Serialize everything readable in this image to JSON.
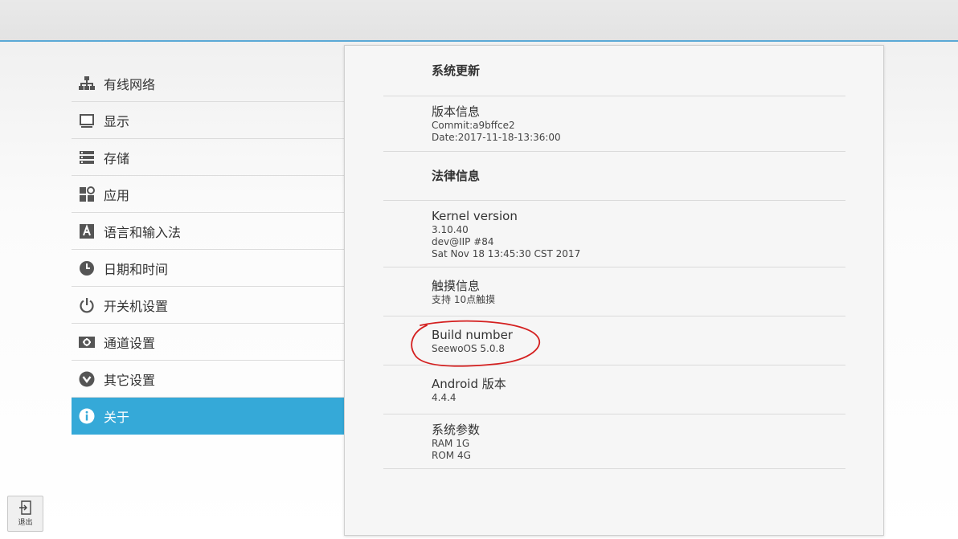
{
  "sidebar": {
    "items": [
      {
        "label": "有线网络",
        "icon": "network-icon"
      },
      {
        "label": "显示",
        "icon": "display-icon"
      },
      {
        "label": "存储",
        "icon": "storage-icon"
      },
      {
        "label": "应用",
        "icon": "apps-icon"
      },
      {
        "label": "语言和输入法",
        "icon": "language-icon"
      },
      {
        "label": "日期和时间",
        "icon": "clock-icon"
      },
      {
        "label": "开关机设置",
        "icon": "power-icon"
      },
      {
        "label": "通道设置",
        "icon": "channel-icon"
      },
      {
        "label": "其它设置",
        "icon": "chevron-down-circle-icon"
      },
      {
        "label": "关于",
        "icon": "info-icon",
        "active": true
      }
    ]
  },
  "about": {
    "system_update": {
      "title": "系统更新"
    },
    "version_info": {
      "title": "版本信息",
      "line1": "Commit:a9bffce2",
      "line2": "Date:2017-11-18-13:36:00"
    },
    "legal_info": {
      "title": "法律信息"
    },
    "kernel": {
      "title": "Kernel version",
      "line1": "3.10.40",
      "line2": "dev@IIP #84",
      "line3": "Sat Nov 18 13:45:30 CST 2017"
    },
    "touch": {
      "title": "触摸信息",
      "line1": "支持 10点触摸"
    },
    "build": {
      "title": "Build number",
      "line1": "SeewoOS 5.0.8"
    },
    "android": {
      "title": "Android 版本",
      "line1": "4.4.4"
    },
    "params": {
      "title": "系统参数",
      "line1": "RAM  1G",
      "line2": "ROM  4G"
    }
  },
  "exit": {
    "label": "退出",
    "icon": "exit-icon"
  },
  "colors": {
    "accent": "#35a9d8",
    "annotation": "#d42020",
    "topbar_line": "#5aa9d6"
  }
}
